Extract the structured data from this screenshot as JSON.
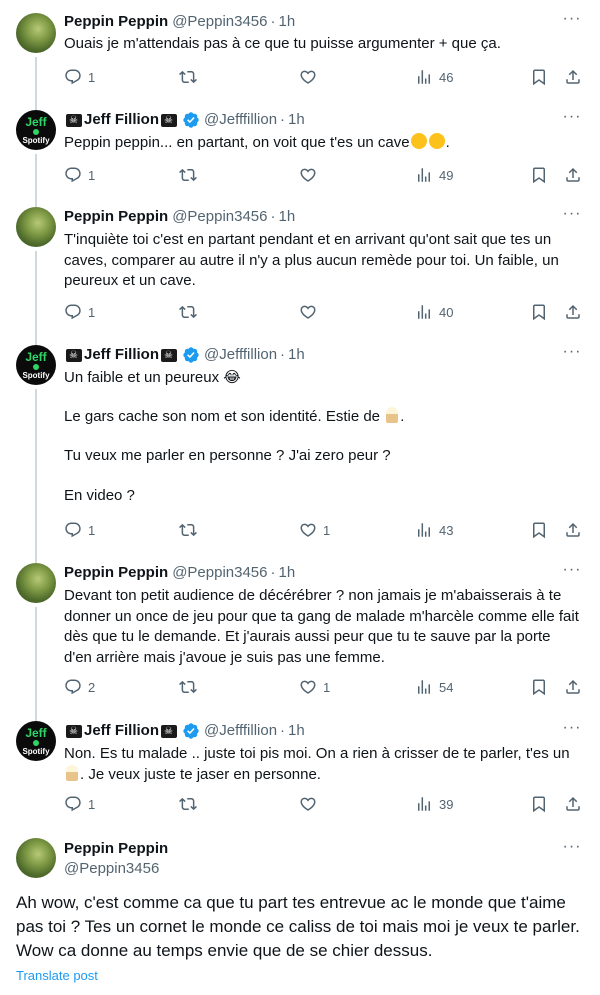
{
  "tweets": [
    {
      "name": "Peppin Peppin",
      "handle": "@Peppin3456",
      "time": "1h",
      "text": "Ouais je m'attendais pas à ce que tu puisse argumenter + que ça.",
      "replies": "1",
      "likes": "",
      "views": "46"
    },
    {
      "name": "Jeff Fillion",
      "handle": "@Jefffillion",
      "time": "1h",
      "text": "Peppin peppin... en partant, on voit que t'es un cave",
      "text_suffix": ".",
      "replies": "1",
      "likes": "",
      "views": "49"
    },
    {
      "name": "Peppin Peppin",
      "handle": "@Peppin3456",
      "time": "1h",
      "text": "T'inquiète toi c'est en partant pendant et en arrivant qu'ont sait que tes un caves, comparer au autre il n'y a plus aucun remède pour toi. Un faible, un peureux et un cave.",
      "replies": "1",
      "likes": "",
      "views": "40"
    },
    {
      "name": "Jeff Fillion",
      "handle": "@Jefffillion",
      "time": "1h",
      "line1": "Un faible et un peureux 😂",
      "line2a": "Le gars cache son nom et son identité. Estie de",
      "line2b": ".",
      "line3": "Tu veux me parler en personne ? J'ai zero peur ?",
      "line4": "En video ?",
      "replies": "1",
      "likes": "1",
      "views": "43"
    },
    {
      "name": "Peppin Peppin",
      "handle": "@Peppin3456",
      "time": "1h",
      "text": "Devant ton petit audience de décérébrer ? non jamais je m'abaisserais à te donner un once de jeu pour que ta gang de malade m'harcèle comme elle fait dès que tu le demande. Et j'aurais aussi peur que tu te sauve par la porte d'en arrière mais j'avoue je suis pas une femme.",
      "replies": "2",
      "likes": "1",
      "views": "54"
    },
    {
      "name": "Jeff Fillion",
      "handle": "@Jefffillion",
      "time": "1h",
      "text_a": "Non. Es tu malade .. juste toi pis moi. On a rien à crisser de te parler, t'es un",
      "text_b": ". Je veux juste te jaser en personne.",
      "replies": "1",
      "likes": "",
      "views": "39"
    }
  ],
  "main_tweet": {
    "name": "Peppin Peppin",
    "handle": "@Peppin3456",
    "text": "Ah wow, c'est comme ca que tu part tes entrevue ac le monde que t'aime pas toi ? Tes un cornet le monde ce caliss de toi mais moi je veux te parler. Wow ca donne au temps envie que de se chier dessus.",
    "translate": "Translate post"
  },
  "avatars": {
    "jeff_top": "Jeff",
    "jeff_bottom": "Spotify"
  },
  "colors": {
    "accent": "#1d9bf0",
    "muted": "#536471",
    "line": "#cfd9de"
  }
}
